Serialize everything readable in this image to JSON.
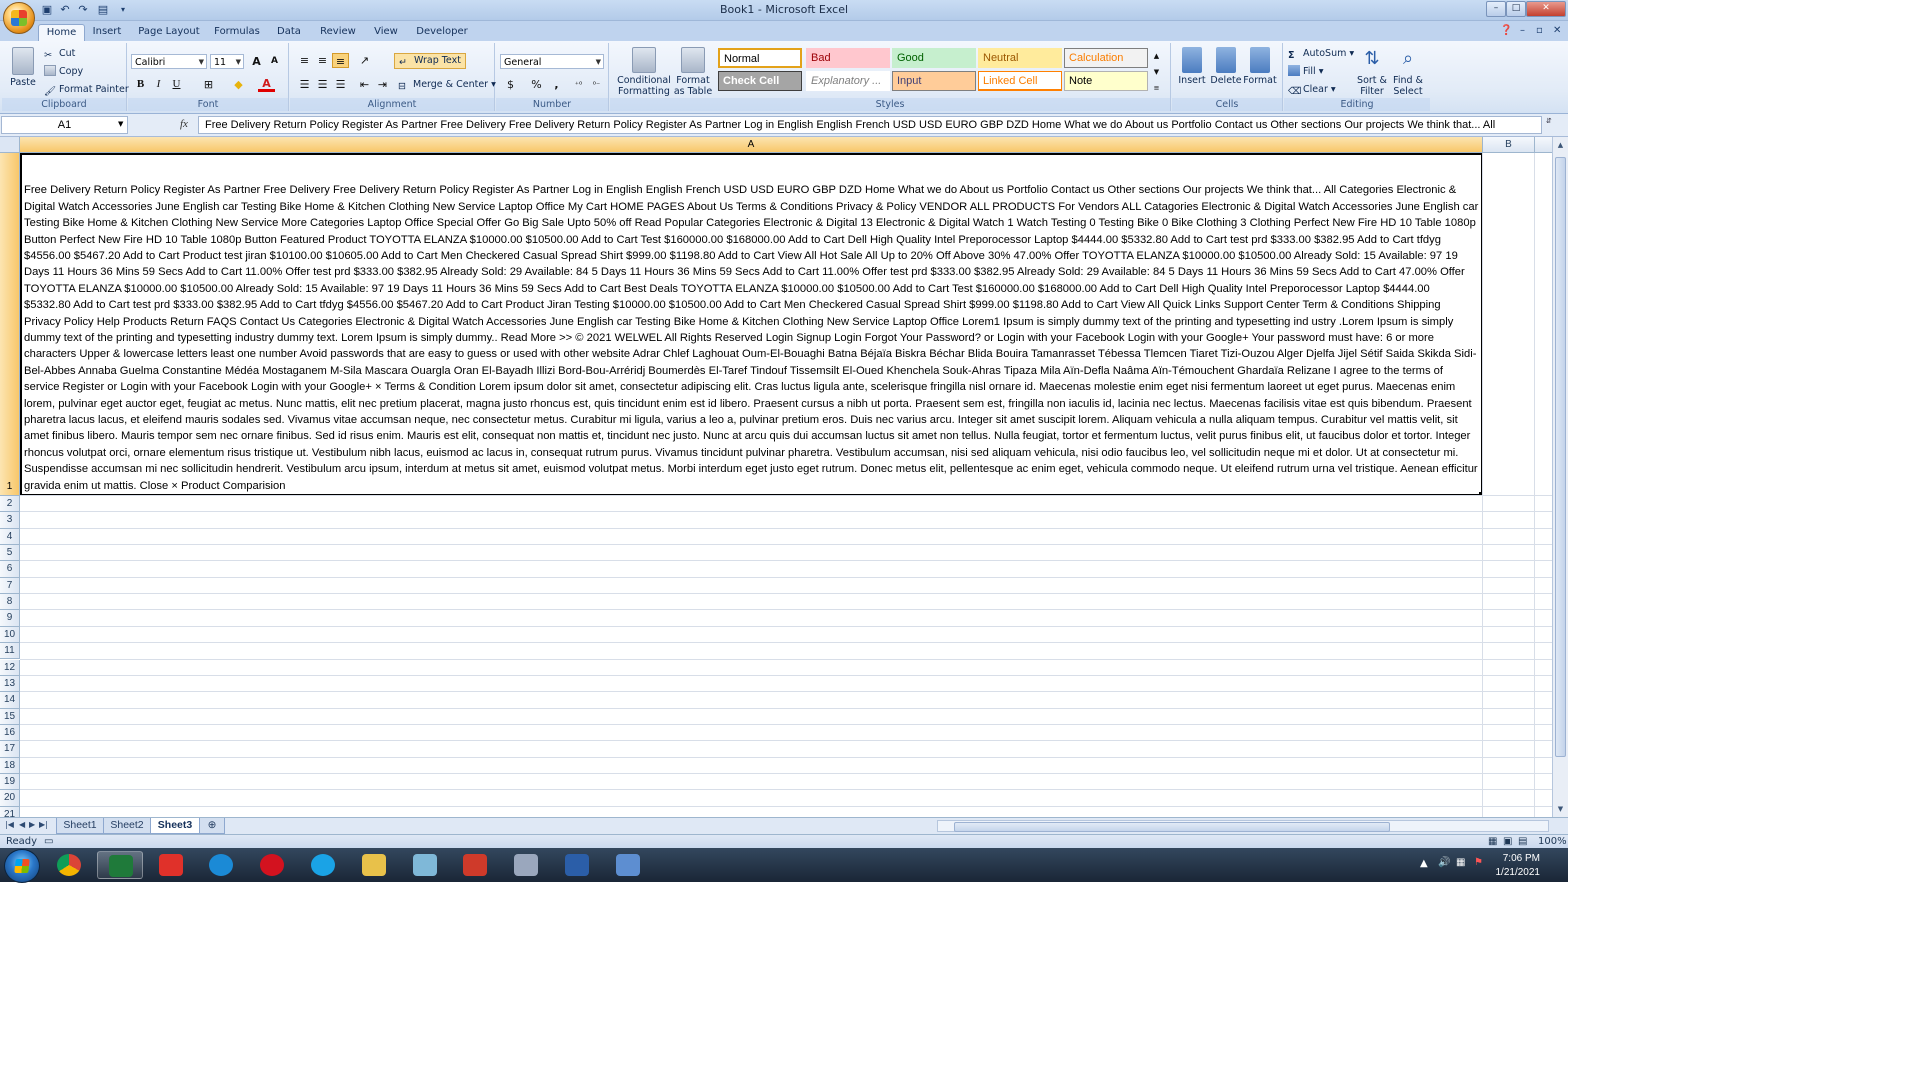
{
  "window": {
    "title": "Book1 - Microsoft Excel",
    "controls": {
      "minimize": "–",
      "maximize": "□",
      "close": "✕"
    }
  },
  "ribbon_tabs": [
    "Home",
    "Insert",
    "Page Layout",
    "Formulas",
    "Data",
    "Review",
    "View",
    "Developer"
  ],
  "clipboard": {
    "paste": "Paste",
    "cut": "Cut",
    "copy": "Copy",
    "format_painter": "Format Painter",
    "label": "Clipboard"
  },
  "font": {
    "name": "Calibri",
    "size": "11",
    "bold": "B",
    "italic": "I",
    "underline": "U",
    "label": "Font",
    "grow": "A",
    "shrink": "A"
  },
  "alignment": {
    "wrap_text": "Wrap Text",
    "merge_center": "Merge & Center",
    "label": "Alignment"
  },
  "number": {
    "format": "General",
    "currency": "$",
    "percent": "%",
    "comma": ",",
    "label": "Number"
  },
  "styles": {
    "conditional_formatting": [
      "Conditional",
      "Formatting"
    ],
    "format_as_table": [
      "Format",
      "as Table"
    ],
    "cells": [
      {
        "label": "Normal",
        "bg": "#ffffff",
        "fg": "#000000",
        "border": "#e3a21a"
      },
      {
        "label": "Bad",
        "bg": "#ffc7ce",
        "fg": "#9c0006",
        "border": "#ffc7ce"
      },
      {
        "label": "Good",
        "bg": "#c6efce",
        "fg": "#006100",
        "border": "#c6efce"
      },
      {
        "label": "Neutral",
        "bg": "#ffeb9c",
        "fg": "#9c5700",
        "border": "#ffeb9c"
      },
      {
        "label": "Calculation",
        "bg": "#f2f2f2",
        "fg": "#fa7d00",
        "border": "#7f7f7f"
      },
      {
        "label": "Check Cell",
        "bg": "#a5a5a5",
        "fg": "#ffffff",
        "border": "#3f3f3f"
      },
      {
        "label": "Explanatory ...",
        "bg": "#ffffff",
        "fg": "#7f7f7f",
        "border": "#ffffff"
      },
      {
        "label": "Input",
        "bg": "#ffcc99",
        "fg": "#3f3f76",
        "border": "#7f7f7f"
      },
      {
        "label": "Linked Cell",
        "bg": "#ffffff",
        "fg": "#fa7d00",
        "border": "#ff8001"
      },
      {
        "label": "Note",
        "bg": "#ffffcc",
        "fg": "#000000",
        "border": "#b2b2b2"
      }
    ],
    "label": "Styles"
  },
  "cells_group": {
    "insert": "Insert",
    "delete": "Delete",
    "format": "Format",
    "label": "Cells"
  },
  "editing": {
    "autosum": "AutoSum",
    "fill": "Fill",
    "clear": "Clear",
    "sort_filter": [
      "Sort &",
      "Filter"
    ],
    "find_select": [
      "Find &",
      "Select"
    ],
    "label": "Editing"
  },
  "formula_bar": {
    "name_box": "A1",
    "fx": "fx",
    "content": "Free Delivery Return Policy Register As Partner Free Delivery Free Delivery Return Policy Register As Partner Log in English English French USD USD EURO GBP DZD Home What we do About us Portfolio Contact us Other sections Our projects We think that... All"
  },
  "grid": {
    "columns": [
      "A",
      "B"
    ],
    "rows": [
      "1",
      "2",
      "3",
      "4",
      "5",
      "6",
      "7",
      "8",
      "9",
      "10",
      "11",
      "12",
      "13",
      "14",
      "15",
      "16",
      "17",
      "18",
      "19",
      "20",
      "21"
    ],
    "cell_a1": "Free Delivery Return Policy Register As Partner Free Delivery Free Delivery Return Policy Register As Partner Log in English English French USD USD EURO GBP DZD Home What we do About us Portfolio Contact us Other sections Our projects We think that... All Categories Electronic & Digital Watch Accessories June English car Testing Bike Home & Kitchen Clothing New Service Laptop Office My Cart HOME PAGES About Us Terms & Conditions Privacy & Policy VENDOR ALL PRODUCTS For Vendors ALL Catagories Electronic & Digital Watch Accessories June English car Testing Bike Home & Kitchen Clothing New Service More Categories Laptop Office Special Offer Go Big Sale Upto 50% off Read Popular Categories Electronic & Digital 13 Electronic & Digital Watch 1 Watch Testing 0 Testing Bike 0 Bike Clothing 3 Clothing Perfect New Fire HD 10 Table 1080p Button Perfect New Fire HD 10 Table 1080p Button Featured Product TOYOTTA ELANZA $10000.00 $10500.00 Add to Cart Test $160000.00 $168000.00 Add to Cart Dell High Quality Intel Preporocessor Laptop $4444.00 $5332.80 Add to Cart test prd $333.00 $382.95 Add to Cart tfdyg $4556.00 $5467.20 Add to Cart Product test jiran $10100.00 $10605.00 Add to Cart Men Checkered Casual Spread Shirt $999.00 $1198.80 Add to Cart View All Hot Sale All Up to 20% Off Above 30% 47.00% Offer TOYOTTA ELANZA $10000.00 $10500.00 Already Sold: 15 Available: 97 19 Days 11 Hours 36 Mins 59 Secs Add to Cart 11.00% Offer test prd $333.00 $382.95 Already Sold: 29 Available: 84 5 Days 11 Hours 36 Mins 59 Secs Add to Cart 11.00% Offer test prd $333.00 $382.95 Already Sold: 29 Available: 84 5 Days 11 Hours 36 Mins 59 Secs Add to Cart 47.00% Offer TOYOTTA ELANZA $10000.00 $10500.00 Already Sold: 15 Available: 97 19 Days 11 Hours 36 Mins 59 Secs Add to Cart Best Deals TOYOTTA ELANZA $10000.00 $10500.00 Add to Cart Test $160000.00 $168000.00 Add to Cart Dell High Quality Intel Preporocessor Laptop $4444.00 $5332.80 Add to Cart test prd $333.00 $382.95 Add to Cart tfdyg $4556.00 $5467.20 Add to Cart Product Jiran Testing $10000.00 $10500.00 Add to Cart Men Checkered Casual Spread Shirt $999.00 $1198.80 Add to Cart View All Quick Links Support Center Term & Conditions Shipping Privacy Policy Help Products Return FAQS Contact Us Categories Electronic & Digital Watch Accessories June English car Testing Bike Home & Kitchen Clothing New Service Laptop Office Lorem1 Ipsum is simply dummy text of the printing and typesetting ind ustry .Lorem Ipsum is simply dummy text of the printing and typesetting industry dummy text. Lorem Ipsum is simply dummy.. Read More >> © 2021 WELWEL All Rights Reserved Login Signup Login Forgot Your Password? or Login with your Facebook Login with your Google+ Your password must have: 6 or more characters Upper & lowercase letters least one number Avoid passwords that are easy to guess or used with other website Adrar Chlef Laghouat Oum-El-Bouaghi Batna Béjaïa Biskra Béchar Blida Bouira Tamanrasset Tébessa Tlemcen Tiaret Tizi-Ouzou Alger Djelfa Jijel Sétif Saida Skikda Sidi-Bel-Abbes Annaba Guelma Constantine Médéa Mostaganem M-Sila Mascara Ouargla Oran El-Bayadh Illizi Bord-Bou-Arréridj Boumerdès El-Taref Tindouf Tissemsilt El-Oued Khenchela Souk-Ahras Tipaza Mila Aïn-Defla Naâma Aïn-Témouchent Ghardaïa Relizane I agree to the terms of service Register or Login with your Facebook Login with your Google+ × Terms & Condition Lorem ipsum dolor sit amet, consectetur adipiscing elit. Cras luctus ligula ante, scelerisque fringilla nisl ornare id. Maecenas molestie enim eget nisi fermentum laoreet ut eget purus. Maecenas enim lorem, pulvinar eget auctor eget, feugiat ac metus. Nunc mattis, elit nec pretium placerat, magna justo rhoncus est, quis tincidunt enim est id libero. Praesent cursus a nibh ut porta. Praesent sem est, fringilla non iaculis id, lacinia nec lectus. Maecenas facilisis vitae est quis bibendum. Praesent pharetra lacus lacus, et eleifend mauris sodales sed. Vivamus vitae accumsan neque, nec consectetur metus. Curabitur mi ligula, varius a leo a, pulvinar pretium eros. Duis nec varius arcu. Integer sit amet suscipit lorem. Aliquam vehicula a nulla aliquam tempus. Curabitur vel mattis velit, sit amet finibus libero. Mauris tempor sem nec ornare finibus. Sed id risus enim. Mauris est elit, consequat non mattis et, tincidunt nec justo. Nunc at arcu quis dui accumsan luctus sit amet non tellus. Nulla feugiat, tortor et fermentum luctus, velit purus finibus elit, ut faucibus dolor et tortor. Integer rhoncus volutpat orci, ornare elementum risus tristique ut. Vestibulum nibh lacus, euismod ac lacus in, consequat rutrum purus. Vivamus tincidunt pulvinar pharetra. Vestibulum accumsan, nisi sed aliquam vehicula, nisi odio faucibus leo, vel sollicitudin neque mi et dolor. Ut at consectetur mi. Suspendisse accumsan mi nec sollicitudin hendrerit. Vestibulum arcu ipsum, interdum at metus sit amet, euismod volutpat metus. Morbi interdum eget justo eget rutrum. Donec metus elit, pellentesque ac enim eget, vehicula commodo neque. Ut eleifend rutrum urna vel tristique. Aenean efficitur gravida enim ut mattis. Close × Product Comparision"
  },
  "sheets": [
    {
      "name": "Sheet1",
      "active": false
    },
    {
      "name": "Sheet2",
      "active": false
    },
    {
      "name": "Sheet3",
      "active": true
    }
  ],
  "status": {
    "ready": "Ready",
    "zoom": "100%"
  },
  "taskbar": {
    "apps": [
      {
        "name": "chrome-icon",
        "color": "#e3b517"
      },
      {
        "name": "excel-icon",
        "color": "#1f7a3a",
        "active": true
      },
      {
        "name": "anydesk-icon",
        "color": "#e0312a"
      },
      {
        "name": "edge-icon",
        "color": "#1b8ad6"
      },
      {
        "name": "opera-icon",
        "color": "#d3121f"
      },
      {
        "name": "skype-icon",
        "color": "#1aa3e6"
      },
      {
        "name": "file-explorer-icon",
        "color": "#e8c14a"
      },
      {
        "name": "notepad-icon",
        "color": "#7fb8d8"
      },
      {
        "name": "acrobat-icon",
        "color": "#cf3a2a"
      },
      {
        "name": "paint-icon",
        "color": "#9aa7bd"
      },
      {
        "name": "word-icon",
        "color": "#2b5ea8"
      },
      {
        "name": "screen-icon",
        "color": "#5d8ed1"
      }
    ],
    "time": "7:06 PM",
    "date": "1/21/2021"
  }
}
